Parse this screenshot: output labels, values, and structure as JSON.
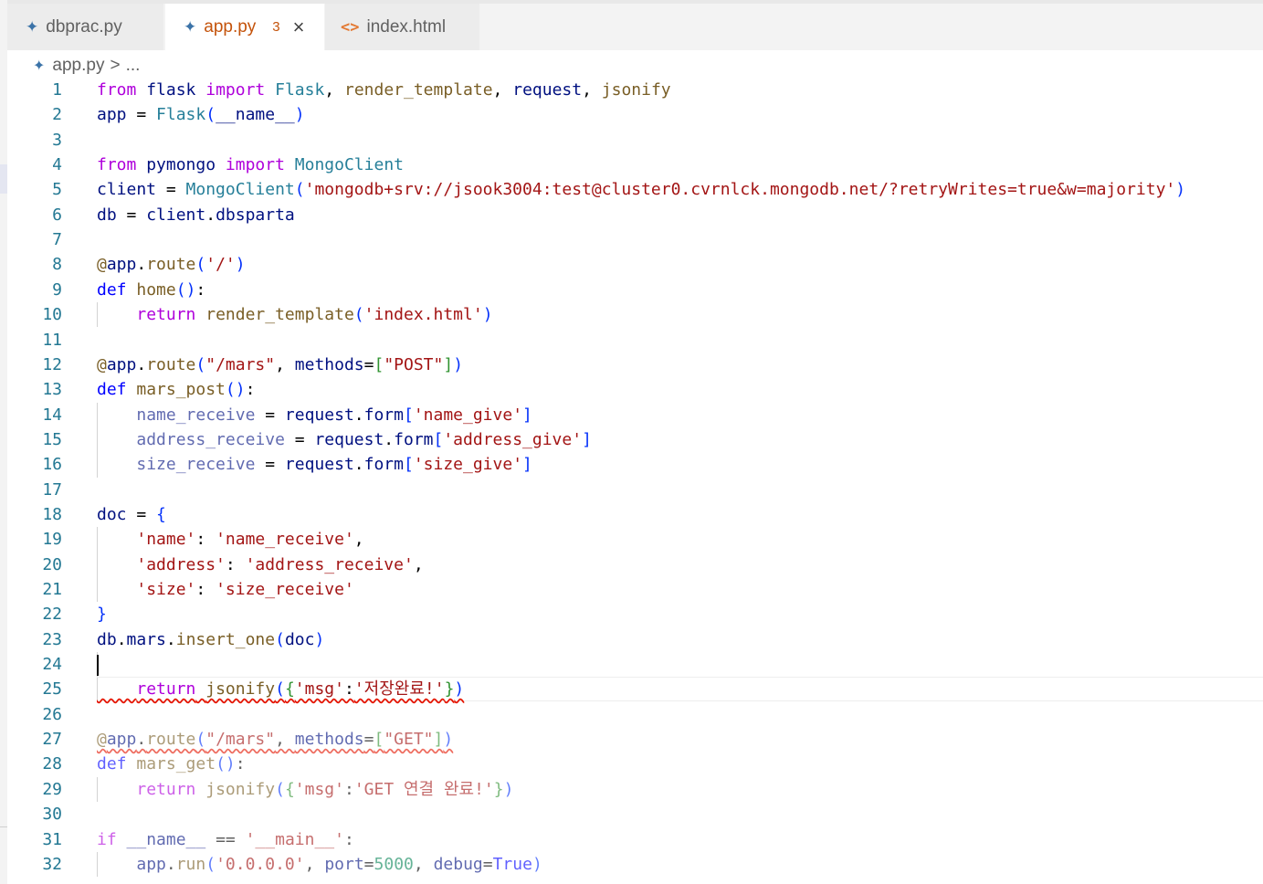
{
  "tabs": [
    {
      "label": "dbprac.py",
      "icon": "python-file-icon",
      "active": false
    },
    {
      "label": "app.py",
      "icon": "python-file-icon",
      "active": true,
      "problems": "3",
      "close": "×"
    },
    {
      "label": "index.html",
      "icon": "html-file-icon",
      "active": false
    }
  ],
  "breadcrumb": {
    "file": "app.py",
    "separator": ">",
    "tail": "..."
  },
  "editor": {
    "language": "python",
    "cursor_line": 24,
    "error_lines": [
      25,
      27
    ],
    "lines": [
      "from flask import Flask, render_template, request, jsonify",
      "app = Flask(__name__)",
      "",
      "from pymongo import MongoClient",
      "client = MongoClient('mongodb+srv://jsook3004:test@cluster0.cvrnlck.mongodb.net/?retryWrites=true&w=majority')",
      "db = client.dbsparta",
      "",
      "@app.route('/')",
      "def home():",
      "    return render_template('index.html')",
      "",
      "@app.route(\"/mars\", methods=[\"POST\"])",
      "def mars_post():",
      "    name_receive = request.form['name_give']",
      "    address_receive = request.form['address_give']",
      "    size_receive = request.form['size_give']",
      "",
      "doc = {",
      "    'name': 'name_receive',",
      "    'address': 'address_receive',",
      "    'size': 'size_receive'",
      "}",
      "db.mars.insert_one(doc)",
      "",
      "    return jsonify({'msg':'저장완료!'})",
      "",
      "@app.route(\"/mars\", methods=[\"GET\"])",
      "def mars_get():",
      "    return jsonify({'msg':'GET 연결 완료!'})",
      "",
      "if __name__ == '__main__':",
      "    app.run('0.0.0.0', port=5000, debug=True)"
    ]
  },
  "colors": {
    "keyword_control": "#af00db",
    "keyword": "#0000ff",
    "function": "#795e26",
    "string": "#a31515",
    "variable": "#001080",
    "class": "#267f99",
    "number": "#098658",
    "line_number": "#237893",
    "error": "#e51400"
  }
}
